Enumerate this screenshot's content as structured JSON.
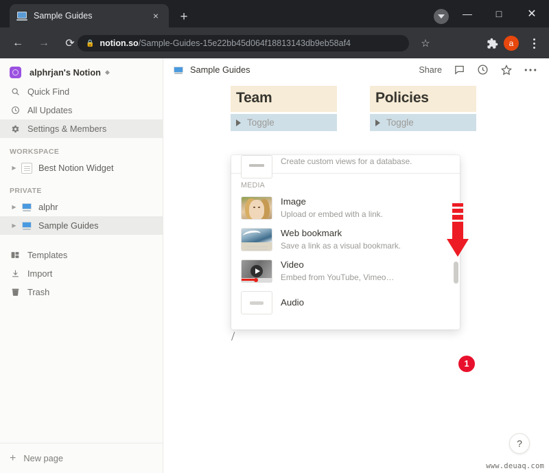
{
  "browser": {
    "tab": {
      "title": "Sample Guides",
      "favicon": "monitor-icon",
      "close_label": "×"
    },
    "new_tab_label": "+",
    "window_controls": {
      "download": "▼",
      "minimize": "—",
      "maximize": "□",
      "close": "✕"
    },
    "nav": {
      "back": "←",
      "forward": "→",
      "reload": "⟳"
    },
    "omnibox": {
      "lock": "🔒",
      "domain": "notion.so",
      "path": "/Sample-Guides-15e22bb45d064f18813143db9eb58af4"
    },
    "toolbar": {
      "bookmark": "☆",
      "extensions": "extensions-icon",
      "profile_initial": "a",
      "menu": "kebab-menu-icon"
    }
  },
  "sidebar": {
    "workspace": {
      "name": "alphrjan's Notion",
      "caret": "⌃⌄"
    },
    "items": [
      {
        "label": "Quick Find",
        "icon": "search-icon",
        "active": false
      },
      {
        "label": "All Updates",
        "icon": "clock-icon",
        "active": false
      },
      {
        "label": "Settings & Members",
        "icon": "gear-icon",
        "active": true
      }
    ],
    "sections": [
      {
        "title": "WORKSPACE",
        "pages": [
          {
            "label": "Best Notion Widget",
            "icon": "document-icon",
            "active": false
          }
        ]
      },
      {
        "title": "PRIVATE",
        "pages": [
          {
            "label": "alphr",
            "icon": "monitor-icon",
            "active": false
          },
          {
            "label": "Sample Guides",
            "icon": "monitor-icon",
            "active": true
          }
        ]
      }
    ],
    "bottom_items": [
      {
        "label": "Templates",
        "icon": "templates-icon"
      },
      {
        "label": "Import",
        "icon": "import-icon"
      },
      {
        "label": "Trash",
        "icon": "trash-icon"
      }
    ],
    "new_page": {
      "label": "New page",
      "icon": "plus-icon"
    }
  },
  "main": {
    "breadcrumb": "Sample Guides",
    "breadcrumb_icon": "monitor-icon",
    "actions": {
      "share": "Share",
      "comments": "comment-icon",
      "updates": "clock-icon",
      "favorite": "star-icon",
      "more": "more-options-icon"
    },
    "columns": [
      {
        "heading": "Team",
        "toggle_label": "Toggle"
      },
      {
        "heading": "Policies",
        "toggle_label": "Toggle"
      }
    ],
    "typed_text": "/"
  },
  "popup": {
    "clipped_top_desc": "Create custom views for a database.",
    "section_label": "MEDIA",
    "items": [
      {
        "title": "Image",
        "desc": "Upload or embed with a link.",
        "thumb": "venus-painting-thumbnail"
      },
      {
        "title": "Web bookmark",
        "desc": "Save a link as a visual bookmark.",
        "thumb": "great-wave-thumbnail"
      },
      {
        "title": "Video",
        "desc": "Embed from YouTube, Vimeo…",
        "thumb": "video-play-thumbnail"
      }
    ],
    "clipped_bottom_title": "Audio"
  },
  "annotations": {
    "arrow": "red-down-arrow",
    "badge": "1"
  },
  "footer": {
    "help": "?",
    "watermark": "www.deuaq.com"
  },
  "colors": {
    "accent_red": "#e8112d",
    "notion_header_bg": "#f7ecd7",
    "notion_toggle_bg": "#cfdfe7",
    "chrome_dark": "#202124",
    "profile_orange": "#e8470d"
  }
}
